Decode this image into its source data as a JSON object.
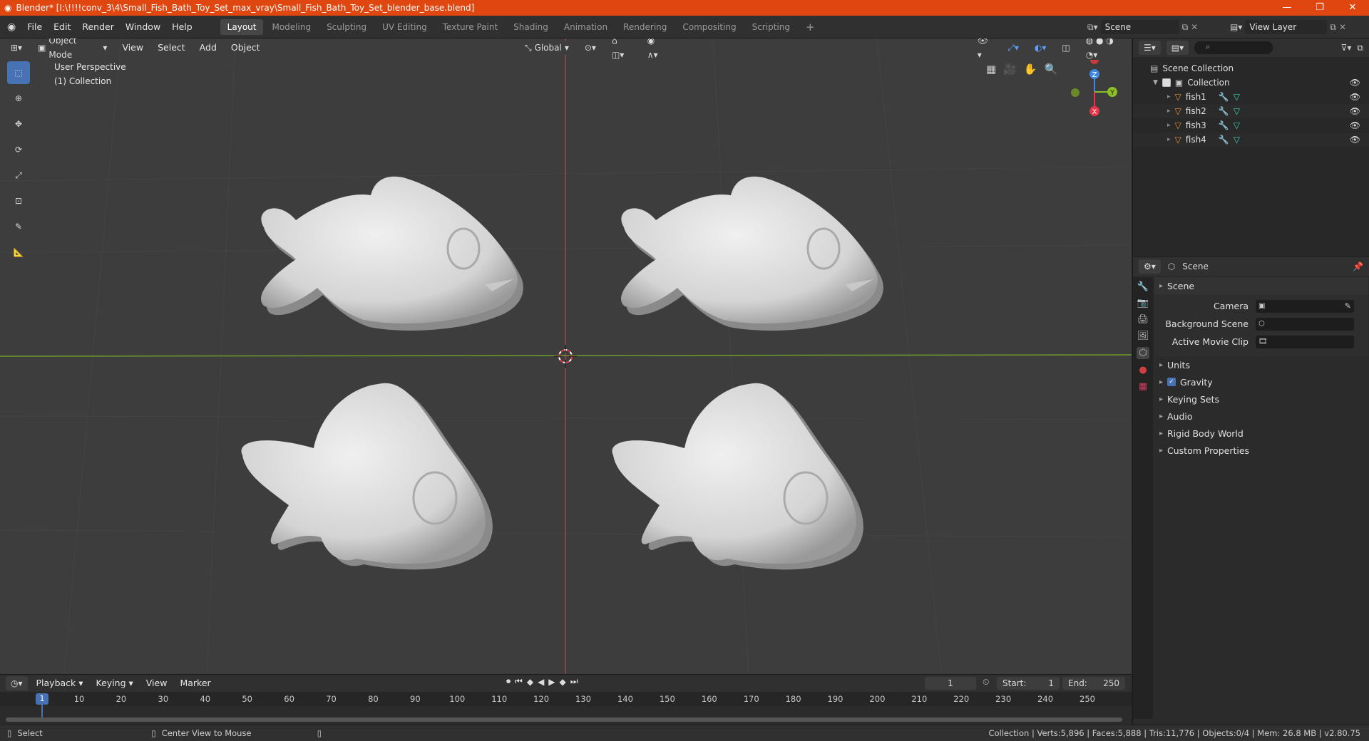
{
  "window": {
    "title": "Blender* [I:\\!!!!conv_3\\4\\Small_Fish_Bath_Toy_Set_max_vray\\Small_Fish_Bath_Toy_Set_blender_base.blend]",
    "minimize": "—",
    "maximize": "❐",
    "close": "✕"
  },
  "menubar": {
    "menus": [
      "File",
      "Edit",
      "Render",
      "Window",
      "Help"
    ],
    "workspaces": [
      "Layout",
      "Modeling",
      "Sculpting",
      "UV Editing",
      "Texture Paint",
      "Shading",
      "Animation",
      "Rendering",
      "Compositing",
      "Scripting"
    ],
    "active_workspace": "Layout",
    "add_tab": "+",
    "scene_name": "Scene",
    "view_layer": "View Layer"
  },
  "viewport": {
    "mode": "Object Mode",
    "menus": [
      "View",
      "Select",
      "Add",
      "Object"
    ],
    "orientation": "Global",
    "overlay_line1": "User Perspective",
    "overlay_line2": "(1) Collection",
    "gizmo": {
      "z": "Z",
      "y": "Y",
      "x": "X"
    }
  },
  "outliner": {
    "root": "Scene Collection",
    "collection": "Collection",
    "objects": [
      "fish1",
      "fish2",
      "fish3",
      "fish4"
    ],
    "search_placeholder": ""
  },
  "properties": {
    "context": "Scene",
    "panel_title": "Scene",
    "fields": [
      {
        "label": "Camera",
        "value": ""
      },
      {
        "label": "Background Scene",
        "value": ""
      },
      {
        "label": "Active Movie Clip",
        "value": ""
      }
    ],
    "sections": [
      "Units",
      "Gravity",
      "Keying Sets",
      "Audio",
      "Rigid Body World",
      "Custom Properties"
    ],
    "gravity_checked": true
  },
  "timeline": {
    "menus": [
      "Playback",
      "Keying",
      "View",
      "Marker"
    ],
    "current_frame": "1",
    "start_label": "Start:",
    "start": "1",
    "end_label": "End:",
    "end": "250",
    "ticks": [
      "1",
      "10",
      "20",
      "30",
      "40",
      "50",
      "60",
      "70",
      "80",
      "90",
      "100",
      "110",
      "120",
      "130",
      "140",
      "150",
      "160",
      "170",
      "180",
      "190",
      "200",
      "210",
      "220",
      "230",
      "240",
      "250"
    ]
  },
  "statusbar": {
    "left": "Select",
    "middle": "Center View to Mouse",
    "right": "Collection | Verts:5,896 | Faces:5,888 | Tris:11,776 | Objects:0/4 | Mem: 26.8 MB | v2.80.75"
  },
  "colors": {
    "accent": "#4772b3",
    "titlebar": "#e0460f",
    "x_axis": "#e8334a",
    "y_axis": "#8cbf26",
    "z_axis": "#3e86e0"
  }
}
